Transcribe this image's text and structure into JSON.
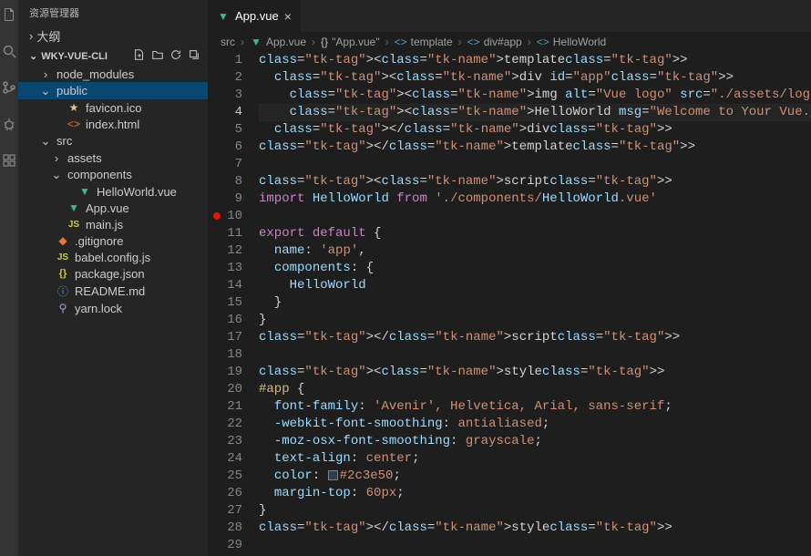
{
  "sidebar": {
    "title": "资源管理器",
    "outline_label": "大纲",
    "project_name": "WKY-VUE-CLI",
    "tree": {
      "node_modules": "node_modules",
      "public": "public",
      "favicon": "favicon.ico",
      "index_html": "index.html",
      "src": "src",
      "assets": "assets",
      "components": "components",
      "helloworld_vue": "HelloWorld.vue",
      "app_vue": "App.vue",
      "main_js": "main.js",
      "gitignore": ".gitignore",
      "babel_config": "babel.config.js",
      "package_json": "package.json",
      "readme": "README.md",
      "yarn_lock": "yarn.lock"
    }
  },
  "tab": {
    "label": "App.vue"
  },
  "breadcrumbs": {
    "src": "src",
    "app_vue": "App.vue",
    "app_vue_str": "\"App.vue\"",
    "template": "template",
    "div_app": "div#app",
    "helloworld": "HelloWorld"
  },
  "code": {
    "l1": "<template>",
    "l2": "  <div id=\"app\">",
    "l3": "    <img alt=\"Vue logo\" src=\"./assets/logo.png\">",
    "l4": "    <HelloWorld msg=\"Welcome to Your Vue.js App\"/>",
    "l5": "  </div>",
    "l6": "</template>",
    "l7": "",
    "l8": "<script>",
    "l9": "import HelloWorld from './components/HelloWorld.vue'",
    "l10": "",
    "l11": "export default {",
    "l12": "  name: 'app',",
    "l13": "  components: {",
    "l14": "    HelloWorld",
    "l15": "  }",
    "l16": "}",
    "l17": "</script>",
    "l18": "",
    "l19": "<style>",
    "l20": "#app {",
    "l21": "  font-family: 'Avenir', Helvetica, Arial, sans-serif;",
    "l22": "  -webkit-font-smoothing: antialiased;",
    "l23": "  -moz-osx-font-smoothing: grayscale;",
    "l24": "  text-align: center;",
    "l25": "  color: #2c3e50;",
    "l26": "  margin-top: 60px;",
    "l27": "}",
    "l28": "</style>",
    "l29": ""
  },
  "line_count": 29,
  "active_line": 4,
  "breakpoint_line": 10
}
